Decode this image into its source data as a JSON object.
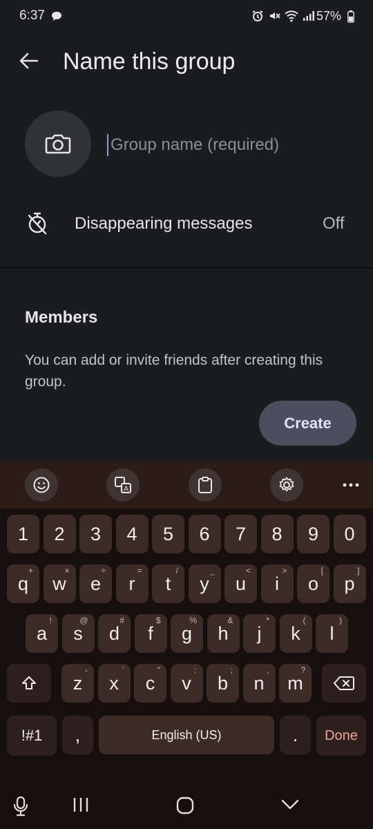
{
  "status_bar": {
    "time": "6:37",
    "battery": "57%"
  },
  "header": {
    "title": "Name this group"
  },
  "group_name": {
    "placeholder": "Group name (required)",
    "value": ""
  },
  "disappearing": {
    "label": "Disappearing messages",
    "value": "Off"
  },
  "members": {
    "heading": "Members",
    "description": "You can add or invite friends after creating this group."
  },
  "actions": {
    "create_label": "Create"
  },
  "keyboard": {
    "toolbar": [
      "emoji-icon",
      "translate-icon",
      "clipboard-icon",
      "settings-icon",
      "more-icon"
    ],
    "number_row": [
      "1",
      "2",
      "3",
      "4",
      "5",
      "6",
      "7",
      "8",
      "9",
      "0"
    ],
    "row1": [
      [
        "q",
        "+"
      ],
      [
        "w",
        "×"
      ],
      [
        "e",
        "÷"
      ],
      [
        "r",
        "="
      ],
      [
        "t",
        "/"
      ],
      [
        "y",
        "_"
      ],
      [
        "u",
        "<"
      ],
      [
        "i",
        ">"
      ],
      [
        "o",
        "["
      ],
      [
        "p",
        "]"
      ]
    ],
    "row2": [
      [
        "a",
        "!"
      ],
      [
        "s",
        "@"
      ],
      [
        "d",
        "#"
      ],
      [
        "f",
        "$"
      ],
      [
        "g",
        "%"
      ],
      [
        "h",
        "&"
      ],
      [
        "j",
        "*"
      ],
      [
        "k",
        "("
      ],
      [
        "l",
        ")"
      ]
    ],
    "row3": [
      [
        "z",
        "-"
      ],
      [
        "x",
        "'"
      ],
      [
        "c",
        "\""
      ],
      [
        "v",
        ":"
      ],
      [
        "b",
        ";"
      ],
      [
        "n",
        ","
      ],
      [
        "m",
        "?"
      ]
    ],
    "symbols_label": "!#1",
    "comma_label": ",",
    "space_label": "English (US)",
    "period_label": ".",
    "done_label": "Done",
    "done_color": "#e8a79a"
  },
  "colors": {
    "background": "#1b1c1f",
    "accent_cursor": "#8c9ce8",
    "create_button": "#4a4f5e"
  }
}
